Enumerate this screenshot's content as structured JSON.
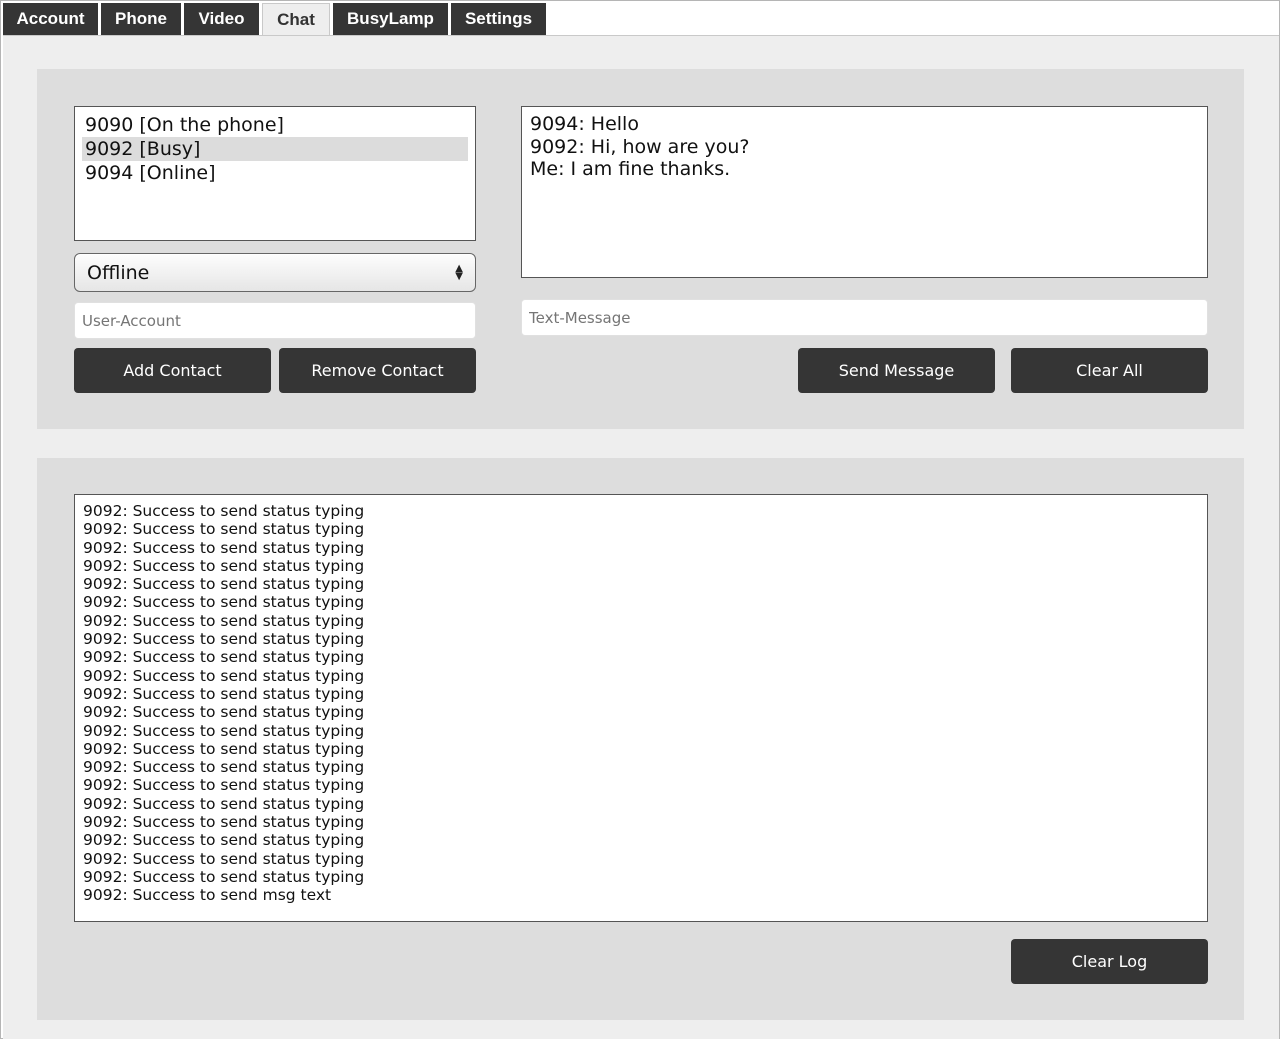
{
  "tabs": [
    {
      "label": "Account"
    },
    {
      "label": "Phone"
    },
    {
      "label": "Video"
    },
    {
      "label": "Chat",
      "active": true
    },
    {
      "label": "BusyLamp"
    },
    {
      "label": "Settings"
    }
  ],
  "contacts": [
    {
      "label": "9090 [On the phone]",
      "selected": false
    },
    {
      "label": "9092 [Busy]",
      "selected": true
    },
    {
      "label": "9094 [Online]",
      "selected": false
    }
  ],
  "status_select": {
    "value": "Offline"
  },
  "user_account_input": {
    "value": "",
    "placeholder": "User-Account"
  },
  "buttons": {
    "add_contact": "Add Contact",
    "remove_contact": "Remove Contact",
    "send_message": "Send Message",
    "clear_all": "Clear All",
    "clear_log": "Clear Log"
  },
  "chat_messages": [
    "9094: Hello",
    "9092: Hi, how are you?",
    "Me: I am fine thanks."
  ],
  "text_message_input": {
    "value": "",
    "placeholder": "Text-Message"
  },
  "log_lines": [
    "9092: Success to send status typing",
    "9092: Success to send status typing",
    "9092: Success to send status typing",
    "9092: Success to send status typing",
    "9092: Success to send status typing",
    "9092: Success to send status typing",
    "9092: Success to send status typing",
    "9092: Success to send status typing",
    "9092: Success to send status typing",
    "9092: Success to send status typing",
    "9092: Success to send status typing",
    "9092: Success to send status typing",
    "9092: Success to send status typing",
    "9092: Success to send status typing",
    "9092: Success to send status typing",
    "9092: Success to send status typing",
    "9092: Success to send status typing",
    "9092: Success to send status typing",
    "9092: Success to send status typing",
    "9092: Success to send status typing",
    "9092: Success to send status typing",
    "9092: Success to send msg text"
  ]
}
